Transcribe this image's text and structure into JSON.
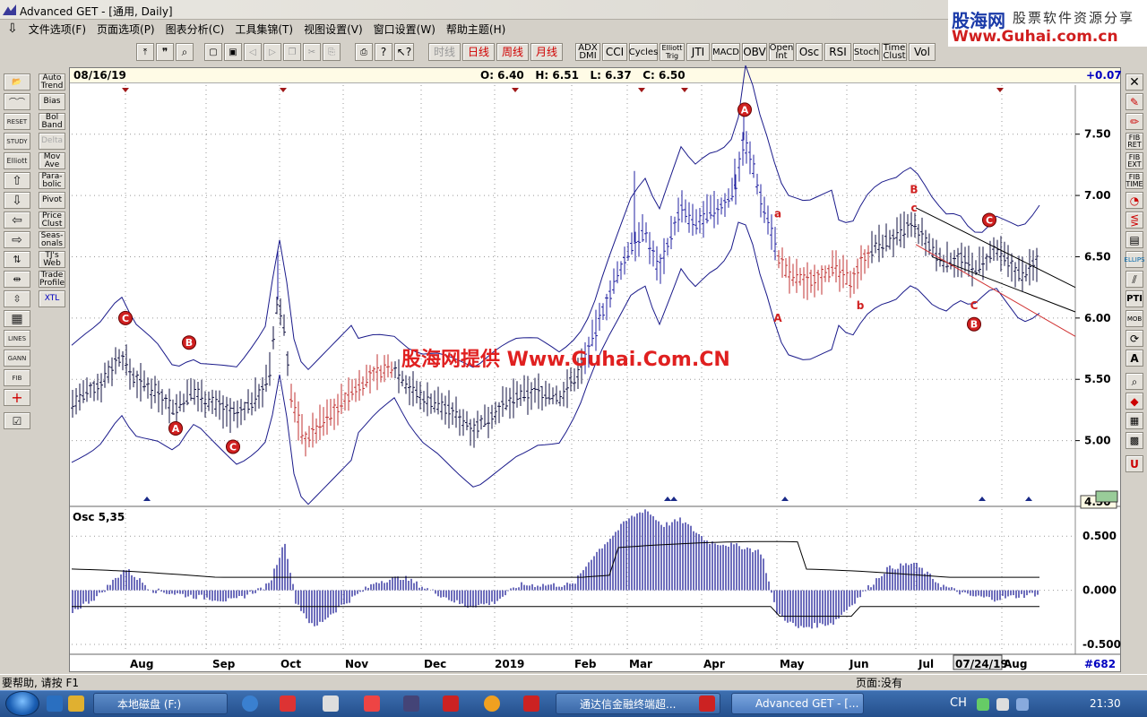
{
  "window": {
    "title": "Advanced GET - [通用, Daily]"
  },
  "watermark": {
    "logo": "股海网",
    "slogan": "股票软件资源分享",
    "url": "Www.Guhai.com.cn"
  },
  "menu": [
    "文件选项(F)",
    "页面选项(P)",
    "图表分析(C)",
    "工具集锦(T)",
    "视图设置(V)",
    "窗口设置(W)",
    "帮助主题(H)"
  ],
  "toolbar": {
    "periods": [
      "时线",
      "日线",
      "周线",
      "月线"
    ],
    "indicators": [
      {
        "label": "ADX\nDMI"
      },
      {
        "label": "CCI"
      },
      {
        "label": "Cycles"
      },
      {
        "label": "Elliott\nTrig"
      },
      {
        "label": "JTI"
      },
      {
        "label": "MACD"
      },
      {
        "label": "OBV"
      },
      {
        "label": "Open\nInt"
      },
      {
        "label": "Osc"
      },
      {
        "label": "RSI"
      },
      {
        "label": "Stoch"
      },
      {
        "label": "Time\nClust"
      },
      {
        "label": "Vol"
      }
    ]
  },
  "left_tools": [
    "RESET",
    "STUDY",
    "Elliott",
    "LINES",
    "GANN",
    "FIB"
  ],
  "study_buttons": [
    "Auto\nTrend",
    "Bias",
    "Bol\nBand",
    "Delta",
    "Mov\nAve",
    "Para-\nbolic",
    "Pivot",
    "Price\nClust",
    "Seas-\nonals",
    "TJ's\nWeb",
    "Trade\nProfile",
    "XTL"
  ],
  "right_tools": [
    "FIB\nRET",
    "FIB\nEXT",
    "FIB\nTIME",
    "ELLIPS",
    "PTI",
    "MOB",
    "A"
  ],
  "chart_info": {
    "date": "08/16/19",
    "ohlc": "O: 6.40   H: 6.51   L: 6.37   C: 6.50",
    "change": "+0.07"
  },
  "chart_watermark": "股海网提供 Www.Guhai.Com.CN",
  "chart_data": {
    "type": "candlestick",
    "price_axis": {
      "ticks": [
        "7.50",
        "7.00",
        "6.50",
        "6.00",
        "5.50",
        "5.00"
      ],
      "current": "4.50",
      "range": [
        4.5,
        7.9
      ]
    },
    "time_axis": [
      "Aug",
      "Sep",
      "Oct",
      "Nov",
      "Dec",
      "2019",
      "Feb",
      "Mar",
      "Apr",
      "May",
      "Jun",
      "Jul",
      "07/24/19",
      "Aug"
    ],
    "elliott_labels": [
      {
        "label": "C",
        "x": "Aug",
        "y": 6.0,
        "boxed": true
      },
      {
        "label": "B",
        "x": "Sep",
        "y": 5.8,
        "boxed": true
      },
      {
        "label": "A",
        "x": "Sep",
        "y": 5.1,
        "boxed": true
      },
      {
        "label": "C",
        "x": "Sep",
        "y": 4.95,
        "boxed": true
      },
      {
        "label": "A",
        "x": "Apr",
        "y": 7.7,
        "boxed": true
      },
      {
        "label": "a",
        "x": "Apr",
        "y": 6.85,
        "boxed": false
      },
      {
        "label": "A",
        "x": "Apr",
        "y": 6.0,
        "boxed": false
      },
      {
        "label": "b",
        "x": "Jun",
        "y": 6.1,
        "boxed": false
      },
      {
        "label": "B",
        "x": "Jul",
        "y": 7.05,
        "boxed": false
      },
      {
        "label": "c",
        "x": "Jul",
        "y": 6.9,
        "boxed": false
      },
      {
        "label": "C",
        "x": "Jul",
        "y": 6.1,
        "boxed": false
      },
      {
        "label": "B",
        "x": "Jul",
        "y": 5.95,
        "boxed": true
      },
      {
        "label": "C",
        "x": "Aug",
        "y": 6.8,
        "boxed": true
      }
    ],
    "oscillator": {
      "name": "Osc 5,35",
      "ticks": [
        "0.500",
        "0.000",
        "-0.500"
      ],
      "range": [
        -0.55,
        0.75
      ]
    },
    "bar_count": "#682"
  },
  "statusbar": {
    "left": "要帮助, 请按 F1",
    "right": "页面:没有"
  },
  "taskbar": {
    "tasks": [
      "本地磁盘 (F:)",
      "通达信金融终端超...",
      "Advanced GET - [..."
    ],
    "clock": "21:30",
    "lang": "CH"
  }
}
